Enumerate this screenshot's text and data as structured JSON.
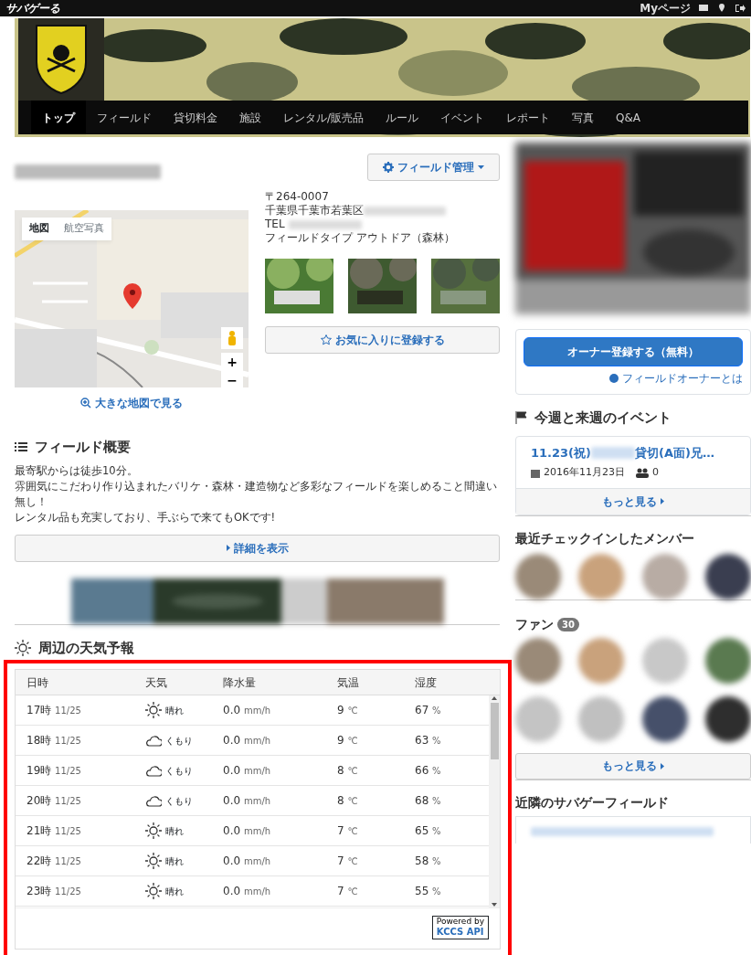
{
  "topbar": {
    "logo": "サバゲーる",
    "links": [
      {
        "kind": "text",
        "label": "Myページ"
      },
      {
        "kind": "mail"
      },
      {
        "kind": "pin"
      },
      {
        "kind": "logout"
      }
    ]
  },
  "nav": [
    {
      "label": "トップ",
      "selected": true
    },
    {
      "label": "フィールド",
      "selected": false
    },
    {
      "label": "貸切料金",
      "selected": false
    },
    {
      "label": "施設",
      "selected": false
    },
    {
      "label": "レンタル/販売品",
      "selected": false
    },
    {
      "label": "ルール",
      "selected": false
    },
    {
      "label": "イベント",
      "selected": false
    },
    {
      "label": "レポート",
      "selected": false
    },
    {
      "label": "写真",
      "selected": false
    },
    {
      "label": "Q&A",
      "selected": false
    }
  ],
  "field_admin_button": "フィールド管理",
  "map": {
    "type_buttons": [
      {
        "label": "地図",
        "selected": true
      },
      {
        "label": "航空写真",
        "selected": false
      }
    ],
    "zoom_in": "+",
    "zoom_out": "−",
    "link": "大きな地図で見る"
  },
  "address": {
    "postal": "〒264-0007",
    "address": "千葉県千葉市若葉区",
    "tel_label": "TEL",
    "field_type": "フィールドタイプ アウトドア（森林）"
  },
  "favorite_button": "お気に入りに登録する",
  "overview": {
    "heading": "フィールド概要",
    "lines": [
      "最寄駅からは徒歩10分。",
      "雰囲気にこだわり作り込まれたバリケ・森林・建造物など多彩なフィールドを楽しめること間違い無し！",
      "レンタル品も充実しており、手ぶらで来てもOKです!"
    ],
    "details_button": "詳細を表示"
  },
  "weather": {
    "heading": "周辺の天気予報",
    "highlighted": true,
    "columns": [
      "日時",
      "天気",
      "降水量",
      "気温",
      "湿度"
    ],
    "rows": [
      {
        "hour": "17時",
        "date": "11/25",
        "kind": "sunny",
        "label": "晴れ",
        "rain": "0.0",
        "rain_unit": "mm/h",
        "temp": "9",
        "temp_unit": "℃",
        "humidity": "67",
        "humidity_unit": "%"
      },
      {
        "hour": "18時",
        "date": "11/25",
        "kind": "cloudy",
        "label": "くもり",
        "rain": "0.0",
        "rain_unit": "mm/h",
        "temp": "9",
        "temp_unit": "℃",
        "humidity": "63",
        "humidity_unit": "%"
      },
      {
        "hour": "19時",
        "date": "11/25",
        "kind": "cloudy",
        "label": "くもり",
        "rain": "0.0",
        "rain_unit": "mm/h",
        "temp": "8",
        "temp_unit": "℃",
        "humidity": "66",
        "humidity_unit": "%"
      },
      {
        "hour": "20時",
        "date": "11/25",
        "kind": "cloudy",
        "label": "くもり",
        "rain": "0.0",
        "rain_unit": "mm/h",
        "temp": "8",
        "temp_unit": "℃",
        "humidity": "68",
        "humidity_unit": "%"
      },
      {
        "hour": "21時",
        "date": "11/25",
        "kind": "sunny",
        "label": "晴れ",
        "rain": "0.0",
        "rain_unit": "mm/h",
        "temp": "7",
        "temp_unit": "℃",
        "humidity": "65",
        "humidity_unit": "%"
      },
      {
        "hour": "22時",
        "date": "11/25",
        "kind": "sunny",
        "label": "晴れ",
        "rain": "0.0",
        "rain_unit": "mm/h",
        "temp": "7",
        "temp_unit": "℃",
        "humidity": "58",
        "humidity_unit": "%"
      },
      {
        "hour": "23時",
        "date": "11/25",
        "kind": "sunny",
        "label": "晴れ",
        "rain": "0.0",
        "rain_unit": "mm/h",
        "temp": "7",
        "temp_unit": "℃",
        "humidity": "55",
        "humidity_unit": "%"
      }
    ],
    "credit_top": "Powered by",
    "credit": "KCCS API"
  },
  "sidebar": {
    "owner_button": "オーナー登録する（無料）",
    "owner_link": "フィールドオーナーとは",
    "events": {
      "heading": "今週と来週のイベント",
      "items": [
        {
          "title_start": "11.23(祝)",
          "title_end": "貸切(A面)兄…",
          "date": "2016年11月23日",
          "participants": "0"
        }
      ],
      "more": "もっと見る"
    },
    "checkins": {
      "heading": "最近チェックインしたメンバー",
      "avatars": [
        {
          "color": "#9a8a78"
        },
        {
          "color": "#c9a27c"
        },
        {
          "color": "#b8aca4"
        },
        {
          "color": "#3a3e50"
        }
      ]
    },
    "fans": {
      "heading": "ファン",
      "count": "30",
      "avatars": [
        {
          "color": "#9a8a78"
        },
        {
          "color": "#c9a27c"
        },
        {
          "color": "#c8c8c8"
        },
        {
          "color": "#5a7a50"
        },
        {
          "color": "#c4c4c4"
        },
        {
          "color": "#c0c0c0"
        },
        {
          "color": "#46506a"
        },
        {
          "color": "#2e2e2e"
        }
      ],
      "more": "もっと見る"
    },
    "nearby": {
      "heading": "近隣のサバゲーフィールド"
    }
  }
}
